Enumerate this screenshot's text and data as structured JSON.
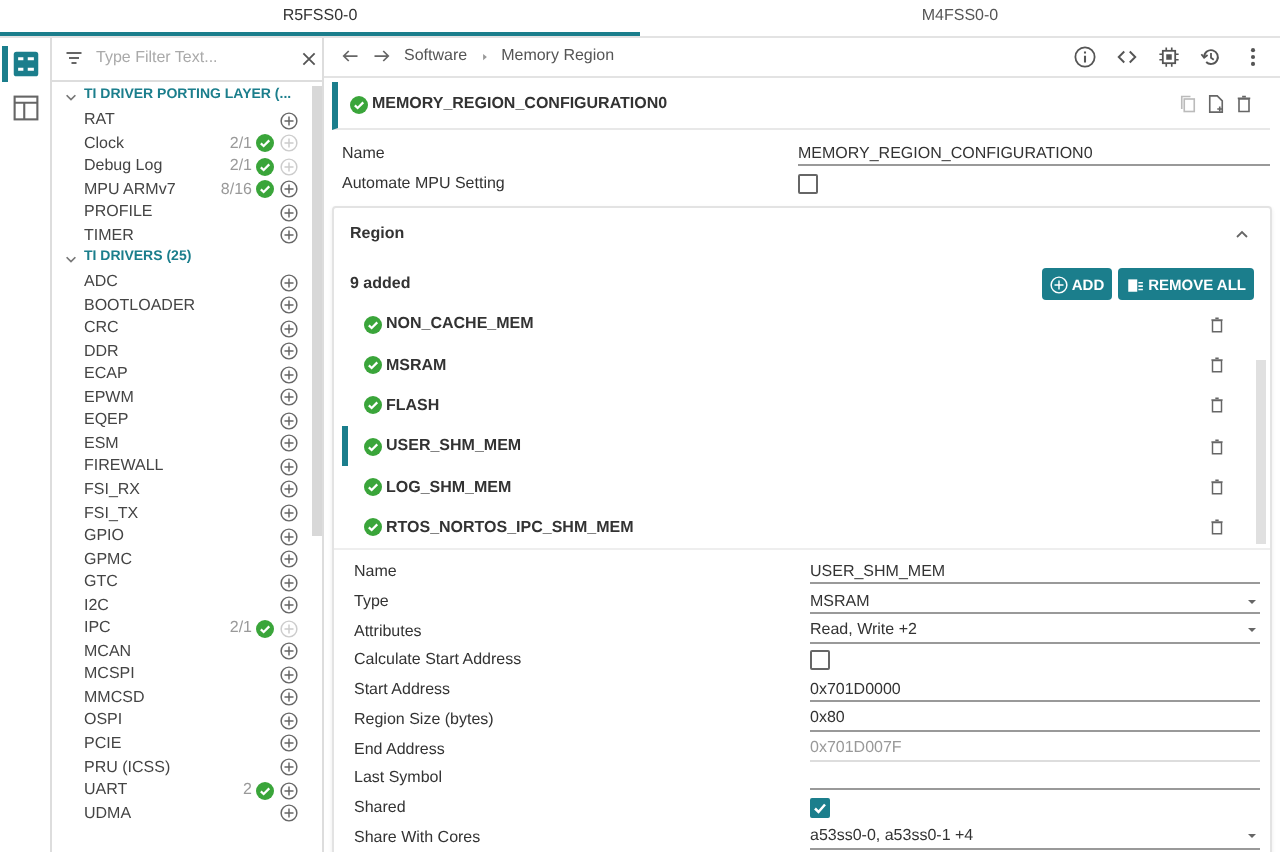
{
  "tabs": [
    {
      "label": "R5FSS0-0",
      "selected": true
    },
    {
      "label": "M4FSS0-0",
      "selected": false
    }
  ],
  "rail": [
    {
      "kind": "list",
      "selected": true
    },
    {
      "kind": "grid",
      "selected": false
    }
  ],
  "filter": {
    "placeholder": "Type Filter Text..."
  },
  "tree": [
    {
      "label": "TI DRIVER PORTING LAYER (...",
      "expanded": true,
      "children": [
        {
          "label": "RAT",
          "checked": false,
          "disabled": false
        },
        {
          "label": "Clock",
          "count": "2/1",
          "checked": true,
          "disabled": true
        },
        {
          "label": "Debug Log",
          "count": "2/1",
          "checked": true,
          "disabled": true
        },
        {
          "label": "MPU ARMv7",
          "count": "8/16",
          "checked": true,
          "disabled": false
        },
        {
          "label": "PROFILE",
          "checked": false,
          "disabled": false
        },
        {
          "label": "TIMER",
          "checked": false,
          "disabled": false
        }
      ]
    },
    {
      "label": "TI DRIVERS (25)",
      "expanded": true,
      "children": [
        {
          "label": "ADC",
          "checked": false,
          "disabled": false
        },
        {
          "label": "BOOTLOADER",
          "checked": false,
          "disabled": false
        },
        {
          "label": "CRC",
          "checked": false,
          "disabled": false
        },
        {
          "label": "DDR",
          "checked": false,
          "disabled": false
        },
        {
          "label": "ECAP",
          "checked": false,
          "disabled": false
        },
        {
          "label": "EPWM",
          "checked": false,
          "disabled": false
        },
        {
          "label": "EQEP",
          "checked": false,
          "disabled": false
        },
        {
          "label": "ESM",
          "checked": false,
          "disabled": false
        },
        {
          "label": "FIREWALL",
          "checked": false,
          "disabled": false
        },
        {
          "label": "FSI_RX",
          "checked": false,
          "disabled": false
        },
        {
          "label": "FSI_TX",
          "checked": false,
          "disabled": false
        },
        {
          "label": "GPIO",
          "checked": false,
          "disabled": false
        },
        {
          "label": "GPMC",
          "checked": false,
          "disabled": false
        },
        {
          "label": "GTC",
          "checked": false,
          "disabled": false
        },
        {
          "label": "I2C",
          "checked": false,
          "disabled": false
        },
        {
          "label": "IPC",
          "count": "2/1",
          "checked": true,
          "disabled": true
        },
        {
          "label": "MCAN",
          "checked": false,
          "disabled": false
        },
        {
          "label": "MCSPI",
          "checked": false,
          "disabled": false
        },
        {
          "label": "MMCSD",
          "checked": false,
          "disabled": false
        },
        {
          "label": "OSPI",
          "checked": false,
          "disabled": false
        },
        {
          "label": "PCIE",
          "checked": false,
          "disabled": false
        },
        {
          "label": "PRU (ICSS)",
          "checked": false,
          "disabled": false
        },
        {
          "label": "UART",
          "count": "2",
          "checked": true,
          "disabled": false
        },
        {
          "label": "UDMA",
          "checked": false,
          "disabled": false
        }
      ]
    }
  ],
  "breadcrumb": [
    "Software",
    "Memory Region"
  ],
  "config": {
    "title": "MEMORY_REGION_CONFIGURATION0",
    "checked": true,
    "fields": [
      {
        "label": "Name",
        "kind": "text",
        "value": "MEMORY_REGION_CONFIGURATION0"
      },
      {
        "label": "Automate MPU Setting",
        "kind": "checkbox",
        "checked": false
      }
    ]
  },
  "region": {
    "title": "Region",
    "expanded": true,
    "count": "9 added",
    "add_button": "ADD",
    "remove_button": "REMOVE ALL",
    "items": [
      {
        "label": "NON_CACHE_MEM",
        "checked": true,
        "selected": false
      },
      {
        "label": "MSRAM",
        "checked": true,
        "selected": false
      },
      {
        "label": "FLASH",
        "checked": true,
        "selected": false
      },
      {
        "label": "USER_SHM_MEM",
        "checked": true,
        "selected": true
      },
      {
        "label": "LOG_SHM_MEM",
        "checked": true,
        "selected": false
      },
      {
        "label": "RTOS_NORTOS_IPC_SHM_MEM",
        "checked": true,
        "selected": false
      }
    ],
    "fields": [
      {
        "label": "Name",
        "kind": "text",
        "value": "USER_SHM_MEM"
      },
      {
        "label": "Type",
        "kind": "select",
        "value": "MSRAM"
      },
      {
        "label": "Attributes",
        "kind": "select",
        "value": "Read, Write +2"
      },
      {
        "label": "Calculate Start Address",
        "kind": "checkbox",
        "checked": false
      },
      {
        "label": "Start Address",
        "kind": "text",
        "value": "0x701D0000"
      },
      {
        "label": "Region Size (bytes)",
        "kind": "text",
        "value": "0x80"
      },
      {
        "label": "End Address",
        "kind": "readonly",
        "value": "0x701D007F"
      },
      {
        "label": "Last Symbol",
        "kind": "text"
      },
      {
        "label": "Shared",
        "kind": "checkbox",
        "checked": true
      },
      {
        "label": "Share With Cores",
        "kind": "select",
        "value": "a53ss0-0, a53ss0-1 +4"
      }
    ]
  }
}
